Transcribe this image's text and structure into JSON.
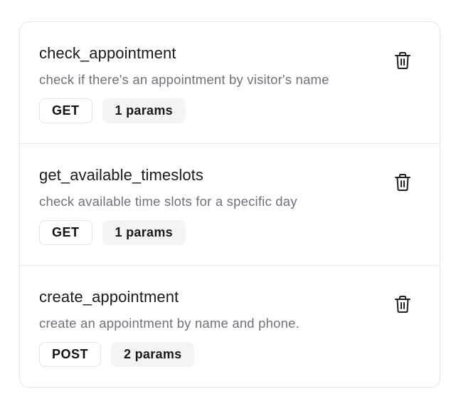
{
  "tools": [
    {
      "name": "check_appointment",
      "description": "check if there's an appointment by visitor's name",
      "method": "GET",
      "params": "1 params"
    },
    {
      "name": "get_available_timeslots",
      "description": "check available time slots for a specific day",
      "method": "GET",
      "params": "1 params"
    },
    {
      "name": "create_appointment",
      "description": "create an appointment by name and phone.",
      "method": "POST",
      "params": "2 params"
    }
  ],
  "icons": {
    "delete": "trash-icon"
  },
  "colors": {
    "text_primary": "#1a1a1a",
    "text_secondary": "#71717a",
    "badge_border": "#e4e4e7",
    "params_bg": "#f4f4f5",
    "card_border": "#e6e6e8"
  }
}
